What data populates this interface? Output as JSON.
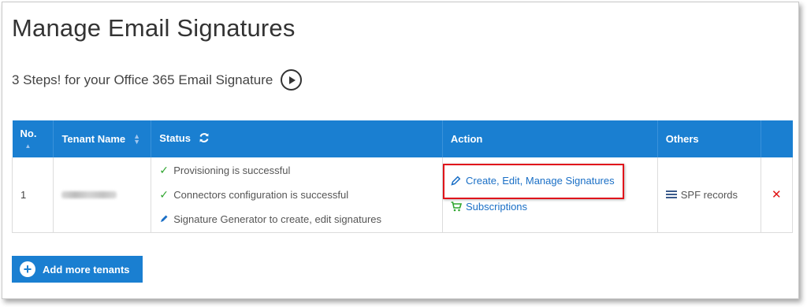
{
  "page": {
    "title": "Manage Email Signatures",
    "steps_text": "3 Steps! for your Office 365 Email Signature"
  },
  "table": {
    "headers": {
      "no": "No.",
      "tenant": "Tenant Name",
      "status": "Status",
      "action": "Action",
      "others": "Others"
    },
    "rows": [
      {
        "no": "1",
        "tenant_blurred": true,
        "status": [
          {
            "icon": "check-icon",
            "text": "Provisioning is successful"
          },
          {
            "icon": "check-icon",
            "text": "Connectors configuration is successful"
          },
          {
            "icon": "pencil-icon",
            "text": "Signature Generator to create, edit signatures"
          }
        ],
        "actions": {
          "edit": "Create, Edit, Manage Signatures",
          "subscriptions": "Subscriptions"
        },
        "others": "SPF records"
      }
    ]
  },
  "add_button": "Add more tenants",
  "colors": {
    "header_blue": "#1a7fd1",
    "link_blue": "#1a6fc6",
    "check_green": "#2fa52f",
    "highlight_red": "#e0141b",
    "delete_red": "#e01414"
  }
}
